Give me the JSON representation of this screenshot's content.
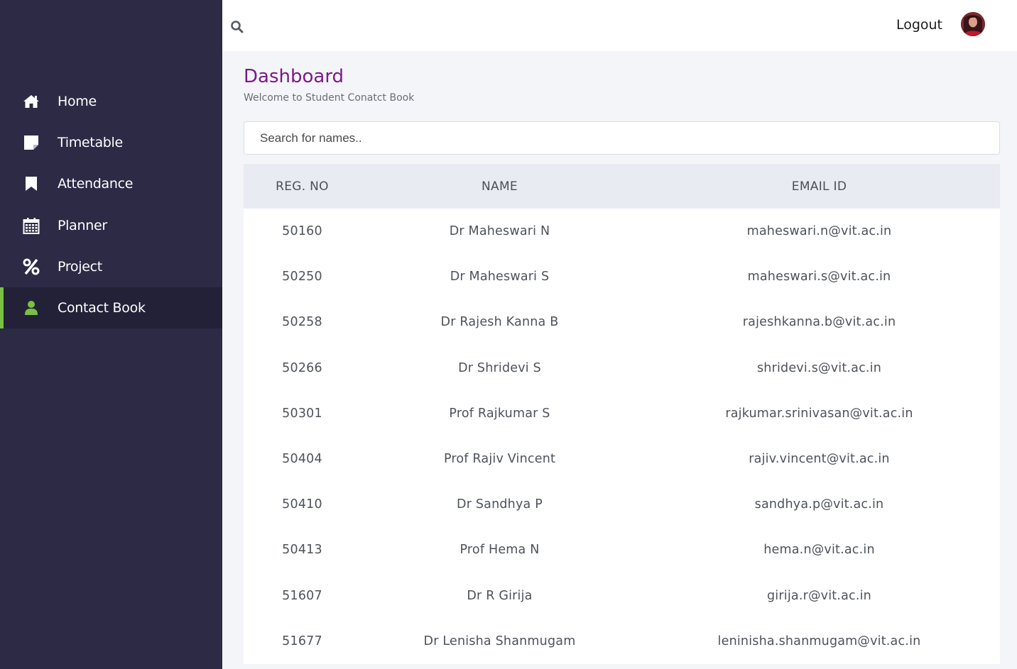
{
  "sidebar": {
    "items": [
      {
        "label": "Home",
        "icon": "home-icon",
        "active": false
      },
      {
        "label": "Timetable",
        "icon": "sticky-note-icon",
        "active": false
      },
      {
        "label": "Attendance",
        "icon": "bookmark-icon",
        "active": false
      },
      {
        "label": "Planner",
        "icon": "calendar-icon",
        "active": false
      },
      {
        "label": "Project",
        "icon": "percent-icon",
        "active": false
      },
      {
        "label": "Contact Book",
        "icon": "user-icon",
        "active": true
      }
    ],
    "accent_color": "#7ac143",
    "background_color": "#2c2a45"
  },
  "header": {
    "search_icon": "search-icon",
    "logout_label": "Logout",
    "avatar": "avatar"
  },
  "main": {
    "title": "Dashboard",
    "subtitle": "Welcome to Student Conatct Book",
    "title_color": "#7b1b84",
    "search_placeholder": "Search for names..",
    "table": {
      "headers": [
        "REG. NO",
        "NAME",
        "EMAIL ID"
      ],
      "rows": [
        {
          "reg": "50160",
          "name": "Dr Maheswari N",
          "email": "maheswari.n@vit.ac.in"
        },
        {
          "reg": "50250",
          "name": "Dr Maheswari S",
          "email": "maheswari.s@vit.ac.in"
        },
        {
          "reg": "50258",
          "name": "Dr Rajesh Kanna B",
          "email": "rajeshkanna.b@vit.ac.in"
        },
        {
          "reg": "50266",
          "name": "Dr Shridevi S",
          "email": "shridevi.s@vit.ac.in"
        },
        {
          "reg": "50301",
          "name": "Prof Rajkumar S",
          "email": "rajkumar.srinivasan@vit.ac.in"
        },
        {
          "reg": "50404",
          "name": "Prof Rajiv Vincent",
          "email": "rajiv.vincent@vit.ac.in"
        },
        {
          "reg": "50410",
          "name": "Dr Sandhya P",
          "email": "sandhya.p@vit.ac.in"
        },
        {
          "reg": "50413",
          "name": "Prof Hema N",
          "email": "hema.n@vit.ac.in"
        },
        {
          "reg": "51607",
          "name": "Dr R Girija",
          "email": "girija.r@vit.ac.in"
        },
        {
          "reg": "51677",
          "name": "Dr Lenisha Shanmugam",
          "email": "leninisha.shanmugam@vit.ac.in"
        }
      ]
    }
  }
}
